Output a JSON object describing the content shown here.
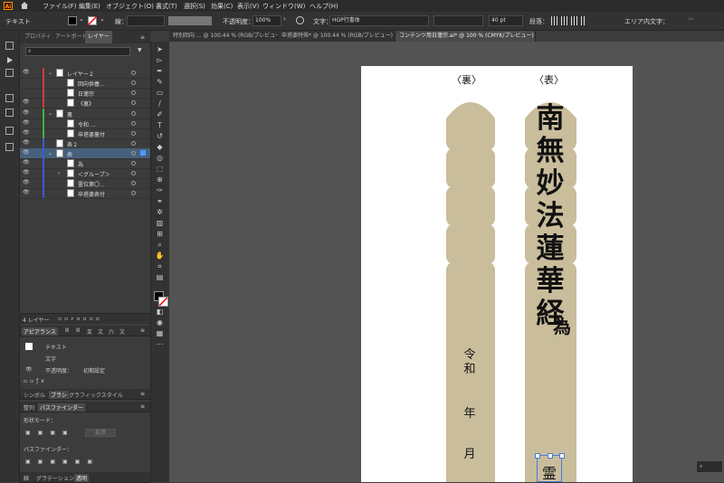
{
  "app": {
    "logo": "Ai"
  },
  "menu": [
    "ファイル(F)",
    "編集(E)",
    "オブジェクト(O)",
    "書式(T)",
    "選択(S)",
    "効果(C)",
    "表示(V)",
    "ウィンドウ(W)",
    "ヘルプ(H)"
  ],
  "control": {
    "type_label": "テキスト",
    "stroke_label": "線：",
    "opacity_label": "不透明度：",
    "opacity_value": "100%",
    "char_label": "文字：",
    "font_value": "HGP行書体",
    "size_value": "40 pt",
    "para_label": "段落：",
    "area_label": "エリア内文字："
  },
  "doc_tabs": [
    "特別回向 ... @ 100.44 % (RGB/プレビュー)",
    "卒塔婆特殊* @ 100.44 % (RGB/プレビュー)",
    "コンテンツ用日蓮宗.ai* @ 100 % (CMYK/プレビュー)"
  ],
  "panel": {
    "tabs": [
      "プロパティ",
      "アートボード",
      "レイヤー"
    ],
    "layers": [
      {
        "name": "レイヤー２",
        "color": "#d23c3c"
      },
      {
        "name": "回向供養...",
        "color": "#d23c3c"
      },
      {
        "name": "日蓮宗",
        "color": "#d23c3c"
      },
      {
        "name": "《裏》",
        "color": "#d23c3c"
      },
      {
        "name": "裏",
        "color": "#3cb43c"
      },
      {
        "name": "令和 ...",
        "color": "#3cb43c"
      },
      {
        "name": "卒塔婆裏付",
        "color": "#3cb43c"
      },
      {
        "name": "表２",
        "color": "#3c5ad2"
      },
      {
        "name": "表",
        "color": "#3c5ad2"
      },
      {
        "name": "為",
        "color": "#3c5ad2"
      },
      {
        "name": "＜グループ＞",
        "color": "#3c5ad2"
      },
      {
        "name": "霊位第〇...",
        "color": "#3c5ad2"
      },
      {
        "name": "卒塔婆表付",
        "color": "#3c5ad2"
      }
    ],
    "layer_count": "4 レイヤー",
    "search_placeholder": "",
    "appearance_tabs": [
      "アピアランス",
      "Ⅲ",
      "Ⅲ",
      "変",
      "文",
      "六",
      "文"
    ],
    "appearance_rows": {
      "t1": "テキスト",
      "t2": "文字",
      "t3_label": "不透明度：",
      "t3_val": "初期設定"
    },
    "brush_tabs": [
      "シンボル",
      "ブラシ",
      "グラフィックスタイル"
    ],
    "pathfinder_tabs": [
      "整列",
      "パスファインダー"
    ],
    "shape_mode": "形状モード：",
    "pathfinder_label": "パスファインダー：",
    "expand_btn": "拡張",
    "bottom_tabs": [
      "線",
      "グラデーション",
      "透明"
    ]
  },
  "canvas": {
    "back_label": "〈裏〉",
    "front_label": "〈表〉",
    "front_main": [
      "南",
      "無",
      "妙",
      "法",
      "蓮",
      "華",
      "経"
    ],
    "front_sub": "為",
    "back_date": [
      "令",
      "和",
      "年",
      "月"
    ],
    "front_bottom": "霊"
  },
  "colors": {
    "stake": "#c9bd9b",
    "accent_selection": "#46607d"
  }
}
